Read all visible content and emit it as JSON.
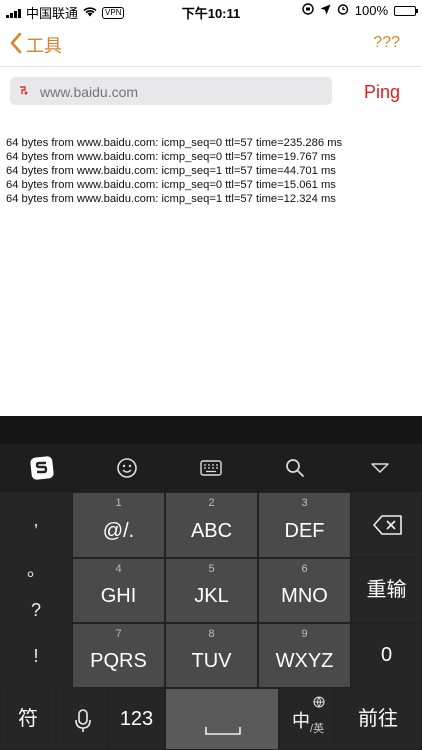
{
  "status_bar": {
    "carrier": "中国联通",
    "vpn": "VPN",
    "time": "下午10:11",
    "battery": "100%"
  },
  "nav": {
    "back_label": "工具",
    "right_label": "???"
  },
  "url_field": {
    "value": "www.baidu.com",
    "placeholder": "www.baidu.com"
  },
  "ping_button": "Ping",
  "output_lines": [
    "64 bytes from www.baidu.com: icmp_seq=0 ttl=57 time=235.286 ms",
    "64 bytes from www.baidu.com: icmp_seq=0 ttl=57 time=19.767 ms",
    "64 bytes from www.baidu.com: icmp_seq=1 ttl=57 time=44.701 ms",
    "64 bytes from www.baidu.com: icmp_seq=0 ttl=57 time=15.061 ms",
    "64 bytes from www.baidu.com: icmp_seq=1 ttl=57 time=12.324 ms"
  ],
  "keyboard": {
    "side_punct": [
      ",",
      "。",
      "?",
      "!"
    ],
    "keys": [
      {
        "num": "1",
        "label": "@/."
      },
      {
        "num": "2",
        "label": "ABC"
      },
      {
        "num": "3",
        "label": "DEF"
      },
      {
        "num": "4",
        "label": "GHI"
      },
      {
        "num": "5",
        "label": "JKL"
      },
      {
        "num": "6",
        "label": "MNO"
      },
      {
        "num": "7",
        "label": "PQRS"
      },
      {
        "num": "8",
        "label": "TUV"
      },
      {
        "num": "9",
        "label": "WXYZ"
      }
    ],
    "right_keys": {
      "rerun": "重输",
      "zero": "0"
    },
    "bottom": {
      "symbol": "符",
      "numbers": "123",
      "lang_main": "中",
      "lang_sub": "英",
      "go": "前往"
    }
  }
}
